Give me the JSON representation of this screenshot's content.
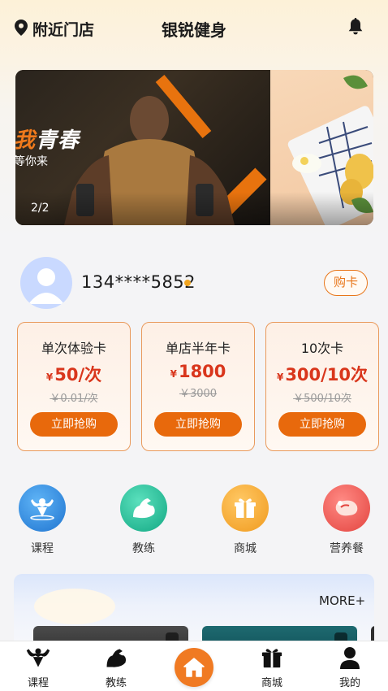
{
  "header": {
    "location_label": "附近门店",
    "title": "银锐健身",
    "icons": [
      "location-pin-icon",
      "bell-icon"
    ]
  },
  "banner": {
    "headline_highlight": "我",
    "headline_rest": "青春",
    "subline": "等你来",
    "indicator": "2/2"
  },
  "user": {
    "phone": "134****5852",
    "buy_card_label": "购卡"
  },
  "cards": [
    {
      "name": "单次体验卡",
      "currency": "¥",
      "price": "50/次",
      "original": "￥0.01/次",
      "button": "立即抢购"
    },
    {
      "name": "单店半年卡",
      "currency": "¥",
      "price": "1800",
      "original": "￥3000",
      "button": "立即抢购"
    },
    {
      "name": "10次卡",
      "currency": "¥",
      "price": "300/10次",
      "original": "￥500/10次",
      "button": "立即抢购"
    }
  ],
  "quick_nav": [
    {
      "label": "课程",
      "icon": "muscle-figure-icon",
      "color": "#2f8fe0"
    },
    {
      "label": "教练",
      "icon": "flexed-arm-icon",
      "color": "#1fbf9a"
    },
    {
      "label": "商城",
      "icon": "gift-box-icon",
      "color": "#f5a72a"
    },
    {
      "label": "营养餐",
      "icon": "meat-icon",
      "color": "#ef5a55"
    }
  ],
  "promo": {
    "more_label": "MORE+"
  },
  "tabbar": {
    "tabs": [
      {
        "label": "课程",
        "icon": "muscle-figure-icon"
      },
      {
        "label": "教练",
        "icon": "flexed-arm-icon"
      },
      {
        "label": "",
        "icon": "home-icon"
      },
      {
        "label": "商城",
        "icon": "gift-box-icon"
      },
      {
        "label": "我的",
        "icon": "user-icon"
      }
    ]
  },
  "colors": {
    "accent": "#e8690c",
    "price": "#d9361c"
  }
}
